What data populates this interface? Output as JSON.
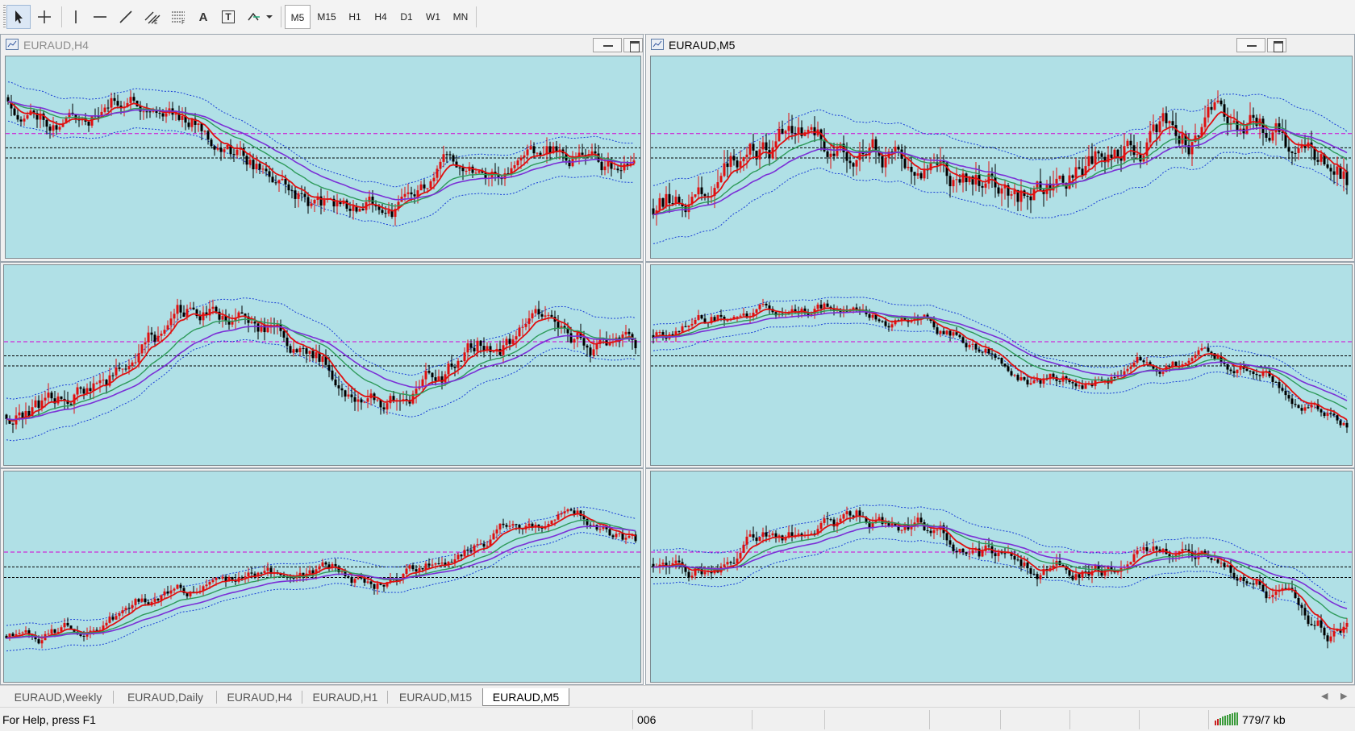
{
  "toolbar": {
    "tools": [
      {
        "name": "cursor-icon"
      },
      {
        "name": "crosshair-icon"
      },
      {
        "name": "vertical-line-icon"
      },
      {
        "name": "horizontal-line-icon"
      },
      {
        "name": "trendline-icon"
      },
      {
        "name": "equidistant-channel-icon"
      },
      {
        "name": "fibonacci-retracement-icon"
      },
      {
        "name": "text-icon",
        "label": "A"
      },
      {
        "name": "text-label-icon",
        "label": "T"
      },
      {
        "name": "arrows-icon"
      }
    ],
    "timeframes": [
      "M5",
      "M15",
      "H1",
      "H4",
      "D1",
      "W1",
      "MN"
    ],
    "active_timeframe": "M5"
  },
  "windows": [
    {
      "title": "EURAUD,H4",
      "active": false
    },
    {
      "title": "EURAUD,M5",
      "active": true
    }
  ],
  "tabs": [
    {
      "label": "EURAUD,Weekly",
      "active": false
    },
    {
      "label": "EURAUD,Daily",
      "active": false
    },
    {
      "label": "EURAUD,H4",
      "active": false
    },
    {
      "label": "EURAUD,H1",
      "active": false
    },
    {
      "label": "EURAUD,M15",
      "active": false
    },
    {
      "label": "EURAUD,M5",
      "active": true
    }
  ],
  "status": {
    "help": "For Help, press F1",
    "profile": "006",
    "traffic": "779/7 kb"
  },
  "colors": {
    "chart_background": "#b0e0e6",
    "bull_candle": "#e01010",
    "bear_candle": "#000000",
    "ma_fast": "#e01010",
    "ma_mid": "#2e9a5a",
    "ma_slow": "#7b2fd6",
    "bollinger": "#1a3fd6",
    "level_magenta": "#d400d4",
    "level_black": "#000000"
  }
}
